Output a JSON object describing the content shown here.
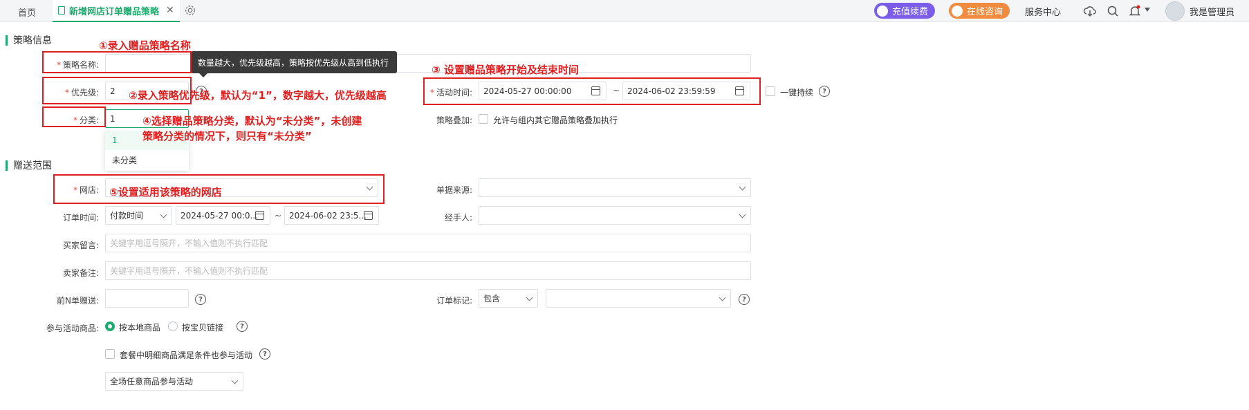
{
  "topbar": {
    "home_tab": "首页",
    "active_tab": "新增网店订单赠品策略",
    "close": "✕",
    "recharge": "充值续费",
    "consult": "在线咨询",
    "service": "服务中心",
    "user": "我是管理员"
  },
  "section1": {
    "title": "策略信息"
  },
  "form1": {
    "name_label": "策略名称:",
    "name_value": "",
    "priority_label": "优先级:",
    "priority_value": "2",
    "category_label": "分类:",
    "category_value": "1",
    "activity_label": "活动时间:",
    "start_time": "2024-05-27 00:00:00",
    "tilde": "~",
    "end_time": "2024-06-02 23:59:59",
    "continuous_label": "一键持续",
    "stack_label": "策略叠加:",
    "stack_option": "允许与组内其它赠品策略叠加执行"
  },
  "tooltip": "数量越大，优先级越高，策略按优先级从高到低执行",
  "category_options": [
    "1",
    "未分类"
  ],
  "annotations": {
    "a1": "①录入赠品策略名称",
    "a2": "②录入策略优先级，默认为“1”，数字越大，优先级越高",
    "a3": "③ 设置赠品策略开始及结束时间",
    "a4_line1": "④选择赠品策略分类，默认为“未分类”，未创建",
    "a4_line2": "策略分类的情况下，则只有“未分类”",
    "a5": "⑤设置适用该策略的网店"
  },
  "section2": {
    "title": "赠送范围"
  },
  "form2": {
    "shop_label": "网店:",
    "source_label": "单据来源:",
    "order_time_label": "订单时间:",
    "order_time_type": "付款时间",
    "order_start": "2024-05-27 00:0...",
    "order_end": "2024-06-02 23:5...",
    "handler_label": "经手人:",
    "buyer_msg_label": "买家留言:",
    "buyer_msg_placeholder": "关键字用逗号隔开，不输入值则不执行匹配",
    "seller_note_label": "卖家备注:",
    "seller_note_placeholder": "关键字用逗号隔开，不输入值则不执行匹配",
    "first_n_label": "前N单赠送:",
    "order_mark_label": "订单标记:",
    "order_mark_op": "包含",
    "products_label": "参与活动商品:",
    "radio_local": "按本地商品",
    "radio_link": "按宝贝链接",
    "package_label": "套餐中明细商品满足条件也参与活动",
    "scope_select": "全场任意商品参与活动"
  },
  "colors": {
    "accent": "#1bab6e",
    "annotation": "#e02020",
    "recharge": "#7a5ee8",
    "consult": "#f08b3f"
  }
}
